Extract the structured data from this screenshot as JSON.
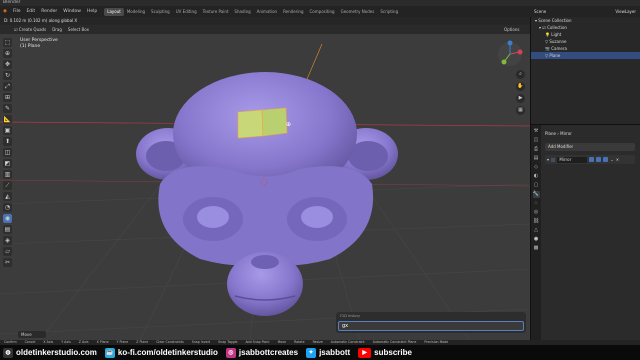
{
  "window": {
    "title": "Blender"
  },
  "menu": [
    "File",
    "Edit",
    "Render",
    "Window",
    "Help"
  ],
  "workspaces": [
    "Layout",
    "Modeling",
    "Sculpting",
    "UV Editing",
    "Texture Paint",
    "Shading",
    "Animation",
    "Rendering",
    "Compositing",
    "Geometry Nodes",
    "Scripting"
  ],
  "active_workspace": "Layout",
  "scene": {
    "label": "Scene",
    "view_layer": "ViewLayer"
  },
  "viewport": {
    "status_line": "D: 0.102 m (0.102 m) along global X",
    "create_quads": "Create Quads",
    "drag_label": "Drag",
    "drag_value": "Select Box",
    "perspective": "User Perspective",
    "object": "(1) Plane",
    "options": "Options",
    "last_operator": "Move"
  },
  "redo_panel": {
    "title": "F2D history",
    "input": "gx"
  },
  "outliner": {
    "rows": [
      {
        "label": "Scene Collection",
        "indent": 0,
        "selected": false
      },
      {
        "label": "Collection",
        "indent": 1,
        "selected": false
      },
      {
        "label": "Light",
        "indent": 2,
        "selected": false
      },
      {
        "label": "Suzanne",
        "indent": 2,
        "selected": false
      },
      {
        "label": "Camera",
        "indent": 2,
        "selected": false
      },
      {
        "label": "Plane",
        "indent": 2,
        "selected": true
      }
    ]
  },
  "properties": {
    "object": "Plane",
    "modifier_tab": "Mirror",
    "add_modifier": "Add Modifier",
    "modifier_name": "Mirror"
  },
  "statusbar": [
    "Confirm",
    "Cancel",
    "X Axis",
    "Y Axis",
    "Z Axis",
    "X Plane",
    "Y Plane",
    "Z Plane",
    "Clear Constraints",
    "Snap Invert",
    "Snap Toggle",
    "Add Snap Point",
    "Move",
    "Rotate",
    "Resize",
    "Automatic Constraint",
    "Automatic Constraint Plane",
    "Precision Mode"
  ],
  "social": {
    "site": "oldetinkerstudio.com",
    "kofi": "ko-fi.com/oldetinkerstudio",
    "instagram": "jsabbottcreates",
    "twitter": "jsabbott",
    "youtube": "subscribe"
  },
  "colors": {
    "accent": "#4772b3",
    "mesh": "#8b7fd4",
    "face": "#c8d878",
    "youtube": "#ff0000"
  }
}
